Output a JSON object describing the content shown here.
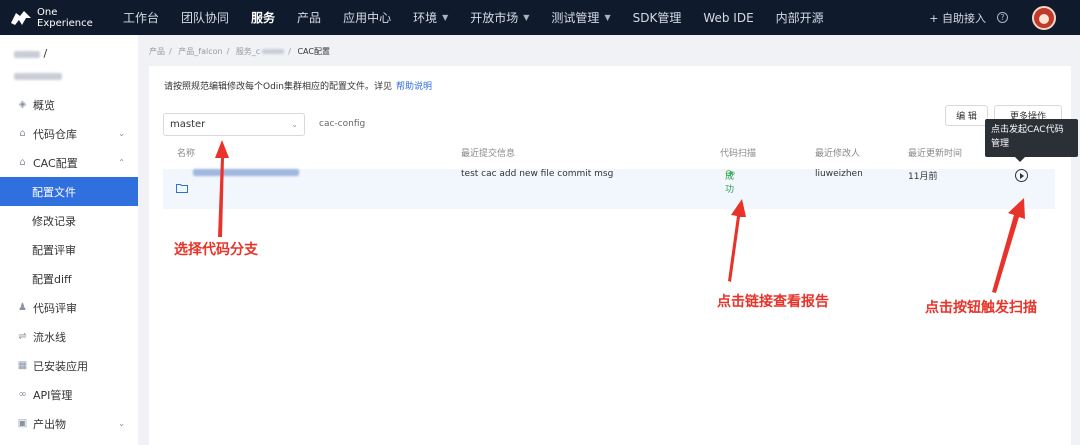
{
  "topbar": {
    "logo_line1": "One",
    "logo_line2": "Experience",
    "nav": [
      "工作台",
      "团队协同",
      "服务",
      "产品",
      "应用中心",
      "环境",
      "开放市场",
      "测试管理",
      "SDK管理",
      "Web IDE",
      "内部开源"
    ],
    "self_access": "+ 自助接入"
  },
  "sidebar": {
    "project_suffix": "/",
    "items": [
      {
        "label": "概览",
        "icon": "layers-icon"
      },
      {
        "label": "代码仓库",
        "icon": "home-icon"
      },
      {
        "label": "CAC配置",
        "icon": "home-icon"
      },
      {
        "label": "配置文件"
      },
      {
        "label": "修改记录"
      },
      {
        "label": "配置评审"
      },
      {
        "label": "配置diff"
      },
      {
        "label": "代码评审",
        "icon": "user-icon"
      },
      {
        "label": "流水线",
        "icon": "pipeline-icon"
      },
      {
        "label": "已安装应用",
        "icon": "grid-icon"
      },
      {
        "label": "API管理",
        "icon": "link-icon"
      },
      {
        "label": "产出物",
        "icon": "box-icon"
      }
    ]
  },
  "breadcrumb": {
    "items": [
      "产品",
      "产品_falcon",
      "服务_c"
    ],
    "current": "CAC配置"
  },
  "content": {
    "description": "请按照规范编辑修改每个Odin集群相应的配置文件。详见",
    "help_link": "帮助说明",
    "branch": "master",
    "repo": "cac-config",
    "edit_button": "编 辑",
    "more_button": "更多操作",
    "columns": [
      "名称",
      "最近提交信息",
      "代码扫描",
      "最近修改人",
      "最近更新时间",
      "操作"
    ],
    "row": {
      "commit_msg": "test cac add new file commit msg",
      "scan_status": "成功",
      "modifier": "liuweizhen",
      "updated": "11月前"
    },
    "tooltip": "点击发起CAC代码管理"
  },
  "annotations": {
    "branch": "选择代码分支",
    "report": "点击链接查看报告",
    "trigger": "点击按钮触发扫描"
  },
  "colors": {
    "accent": "#2f6fde",
    "annotation": "#e8332a",
    "topbar": "#0f1a2d",
    "success": "#2ea44f"
  }
}
